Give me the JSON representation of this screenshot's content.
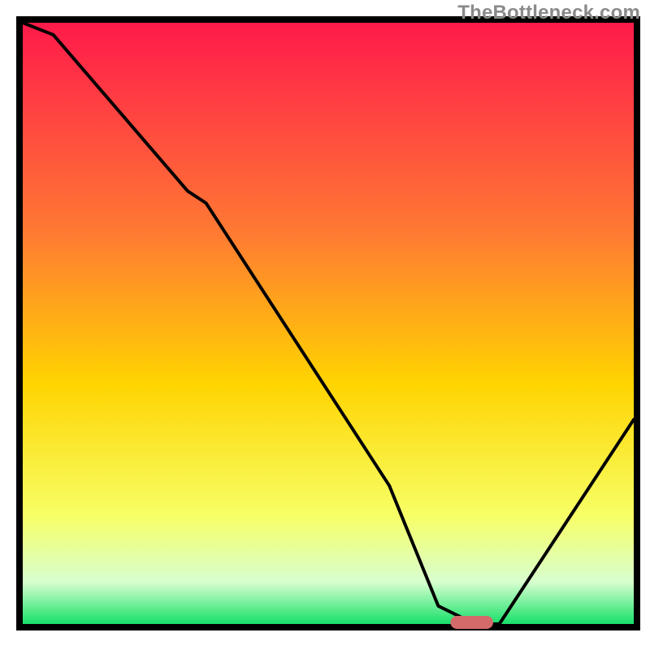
{
  "watermark": "TheBottleneck.com",
  "chart_data": {
    "type": "line",
    "title": "",
    "xlabel": "",
    "ylabel": "",
    "xlim": [
      0,
      100
    ],
    "ylim": [
      0,
      100
    ],
    "x": [
      0,
      5,
      27,
      30,
      60,
      68,
      74,
      78,
      100
    ],
    "values": [
      100,
      98,
      72,
      70,
      23,
      3,
      0,
      0,
      34
    ],
    "marker": {
      "x_start": 70,
      "x_end": 77,
      "y": 0
    },
    "colors": {
      "curve": "#000000",
      "gradient_top": "#ff1a4b",
      "gradient_mid1": "#ff7a33",
      "gradient_mid2": "#ffd400",
      "gradient_mid3": "#f7ff66",
      "gradient_bottom_band": "#d8ffcf",
      "gradient_bottom": "#17e06a",
      "marker": "#d46a6a",
      "frame": "#000000"
    }
  }
}
